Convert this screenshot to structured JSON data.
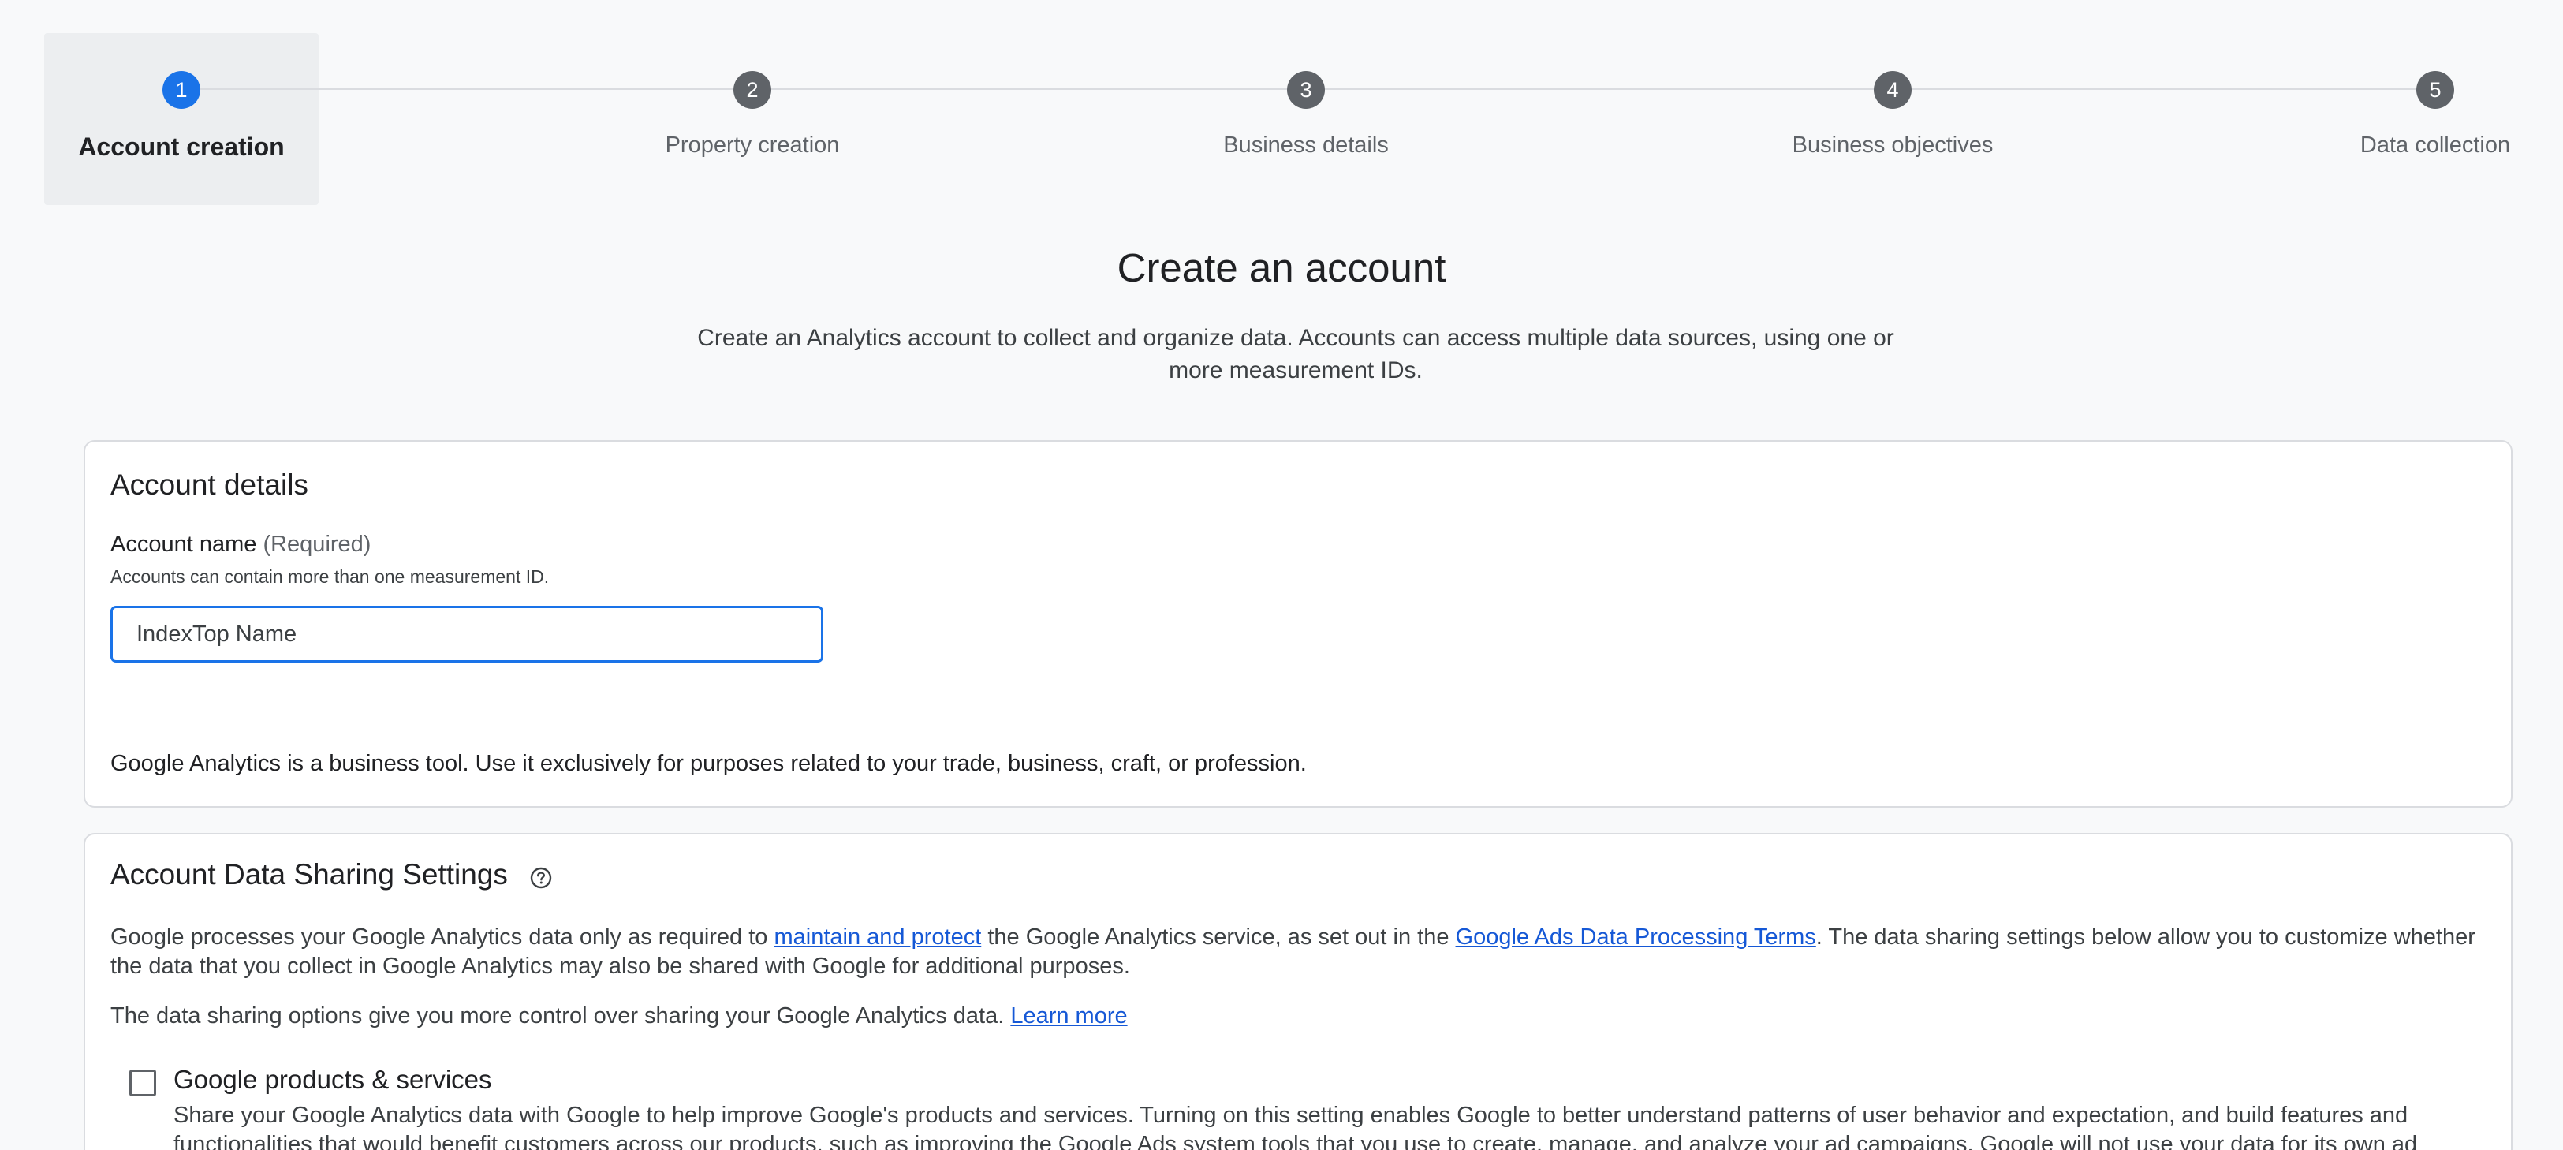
{
  "stepper": {
    "steps": [
      {
        "number": "1",
        "label": "Account creation"
      },
      {
        "number": "2",
        "label": "Property creation"
      },
      {
        "number": "3",
        "label": "Business details"
      },
      {
        "number": "4",
        "label": "Business objectives"
      },
      {
        "number": "5",
        "label": "Data collection"
      }
    ],
    "active_step": 1
  },
  "header": {
    "title": "Create an account",
    "subtitle": "Create an Analytics account to collect and organize data. Accounts can access multiple data sources, using one or more measurement IDs."
  },
  "account_details": {
    "title": "Account details",
    "name_label": "Account name",
    "name_required": "(Required)",
    "name_hint": "Accounts can contain more than one measurement ID.",
    "name_value": "IndexTop Name",
    "business_note": "Google Analytics is a business tool. Use it exclusively for purposes related to your trade, business, craft, or profession."
  },
  "data_sharing": {
    "title": "Account Data Sharing Settings",
    "help_icon": "help-circle-icon",
    "intro_part1": "Google processes your Google Analytics data only as required to ",
    "intro_link1": "maintain and protect",
    "intro_part2": " the Google Analytics service, as set out in the ",
    "intro_link2": "Google Ads Data Processing Terms",
    "intro_part3": ". The data sharing settings below allow you to customize whether the data that you collect in Google Analytics may also be shared with Google for additional purposes.",
    "options_note": "The data sharing options give you more control over sharing your Google Analytics data. ",
    "learn_more": "Learn more",
    "option": {
      "title": "Google products & services",
      "checked": false,
      "description": "Share your Google Analytics data with Google to help improve Google's products and services. Turning on this setting enables Google to better understand patterns of user behavior and expectation, and build features and functionalities that would benefit customers across our products, such as improving the Google Ads system tools that you use to create, manage, and analyze your ad campaigns. Google will not use your data for its own ad"
    }
  },
  "colors": {
    "accent": "#1a73e8",
    "step_inactive": "#5f6368",
    "link": "#1558d6"
  }
}
